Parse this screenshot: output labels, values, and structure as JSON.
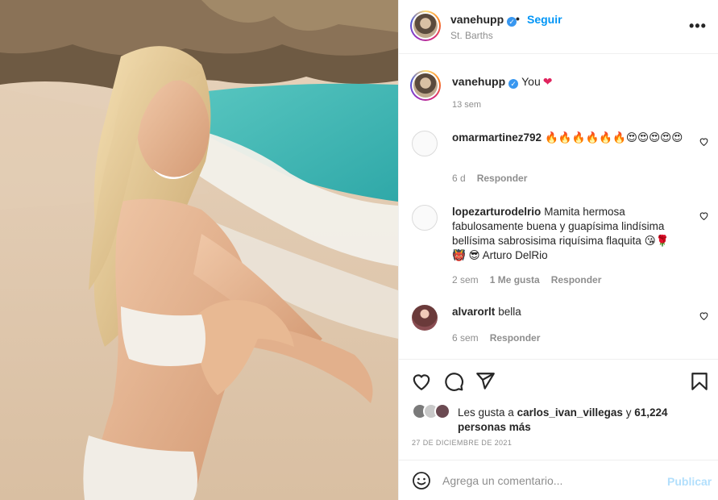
{
  "post": {
    "photo_alt": "beach photo",
    "header": {
      "username": "vanehupp",
      "follow_label": "Seguir",
      "separator": "•",
      "location": "St. Barths",
      "more_label": "•••"
    },
    "caption": {
      "username": "vanehupp",
      "text": "You",
      "heart": "❤",
      "time": "13 sem"
    },
    "comments": [
      {
        "username": "omarmartinez792",
        "text": "🔥🔥🔥🔥🔥🔥😍😍😍😍😍",
        "time": "6 d",
        "likes": "",
        "reply": "Responder"
      },
      {
        "username": "lopezarturodelrio",
        "text": "Mamita hermosa fabulosamente buena y guapísima lindísima bellísima sabrosisima riquísima flaquita 😘🌹👹 😎 Arturo DelRio",
        "time": "2 sem",
        "likes": "1 Me gusta",
        "reply": "Responder"
      },
      {
        "username": "alvarorlt",
        "text": "bella",
        "time": "6 sem",
        "likes": "",
        "reply": "Responder"
      }
    ],
    "likes": {
      "prefix": "Les gusta a",
      "user": "carlos_ivan_villegas",
      "conj": "y",
      "others": "61,224 personas más"
    },
    "date": "27 DE DICIEMBRE DE 2021",
    "add_comment": {
      "placeholder": "Agrega un comentario...",
      "publish_label": "Publicar"
    },
    "icons": {
      "like": "heart-icon",
      "comment": "comment-icon",
      "share": "paper-plane-icon",
      "save": "bookmark-icon",
      "emoji": "smiley-icon",
      "more": "more-options-icon",
      "comment_like": "small-heart-icon"
    },
    "colors": {
      "link_blue": "#0095f6",
      "publish_disabled": "#b2dffc",
      "muted": "#8e8e8e",
      "verified": "#3897f0"
    }
  }
}
